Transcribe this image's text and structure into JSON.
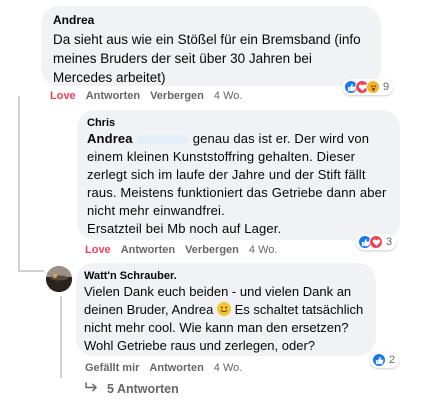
{
  "comments": [
    {
      "author": "Andrea",
      "text": "Da sieht aus wie ein Stößel für ein Bremsband (info meines Bruders der seit über 30 Jahren bei Mercedes arbeitet)",
      "actions": {
        "reaction": "Love",
        "reply": "Antworten",
        "hide": "Verbergen",
        "time": "4 Wo."
      },
      "reaction_count": "9",
      "reactions": [
        "like",
        "love",
        "wow"
      ]
    },
    {
      "author": "Chris",
      "mention": "Andrea",
      "text": "genau das ist er. Der wird von einem kleinen Kunststoffring gehalten. Dieser zerlegt sich im laufe der Jahre und der Stift fällt raus. Meistens funktioniert das Getriebe dann aber nicht mehr einwandfrei.\nErsatzteil bei Mb noch auf Lager.",
      "actions": {
        "reaction": "Love",
        "reply": "Antworten",
        "hide": "Verbergen",
        "time": "4 Wo."
      },
      "reaction_count": "3",
      "reactions": [
        "like",
        "love"
      ]
    },
    {
      "author": "Watt'n Schrauber.",
      "text_part1": "Vielen Dank euch beiden - und vielen Dank an deinen Bruder, Andrea",
      "text_part2": "Es schaltet tatsächlich nicht mehr cool. Wie kann man den ersetzen? Wohl Getriebe raus und zerlegen, oder?",
      "actions": {
        "reaction": "Gefällt mir",
        "reply": "Antworten",
        "time": "4 Wo."
      },
      "reaction_count": "2",
      "reactions": [
        "like"
      ]
    }
  ],
  "replies_link": "5 Antworten",
  "colors": {
    "like": "#1877f2",
    "love": "#f33e58",
    "wow": "#f7b125",
    "bubble": "#f0f2f5",
    "meta": "#65676b"
  }
}
